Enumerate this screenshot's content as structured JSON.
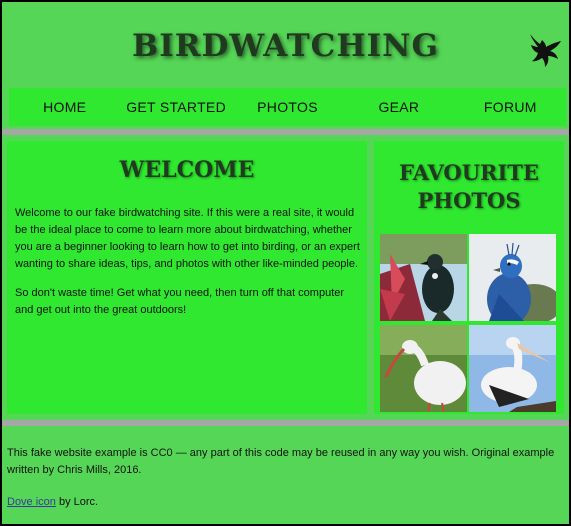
{
  "header": {
    "site_title": "BIRDWATCHING",
    "logo_icon": "bird-logo-icon"
  },
  "nav": {
    "items": [
      "HOME",
      "GET STARTED",
      "PHOTOS",
      "GEAR",
      "FORUM"
    ]
  },
  "main": {
    "heading": "WELCOME",
    "paragraph_1": "Welcome to our fake birdwatching site. If this were a real site, it would be the ideal place to come to learn more about birdwatching, whether you are a beginner looking to learn how to get into birding, or an expert wanting to share ideas, tips, and photos with other like-minded people.",
    "paragraph_2": "So don't waste time! Get what you need, then turn off that computer and get out into the great outdoors!"
  },
  "aside": {
    "heading": "FAVOURITE PHOTOS",
    "photos": [
      "tui-photo",
      "peacock-photo",
      "ibis-photo",
      "pelican-photo"
    ]
  },
  "footer": {
    "line_1": "This fake website example is CC0 — any part of this code may be reused in any way you wish. Original example written by Chris Mills, 2016.",
    "credit_link": "Dove icon",
    "credit_suffix": " by Lorc."
  },
  "colors": {
    "page_bg": "#56d656",
    "panel_bg": "#2fe82f",
    "divider": "#a6a6a6",
    "heading_text": "#1f3a1f"
  }
}
